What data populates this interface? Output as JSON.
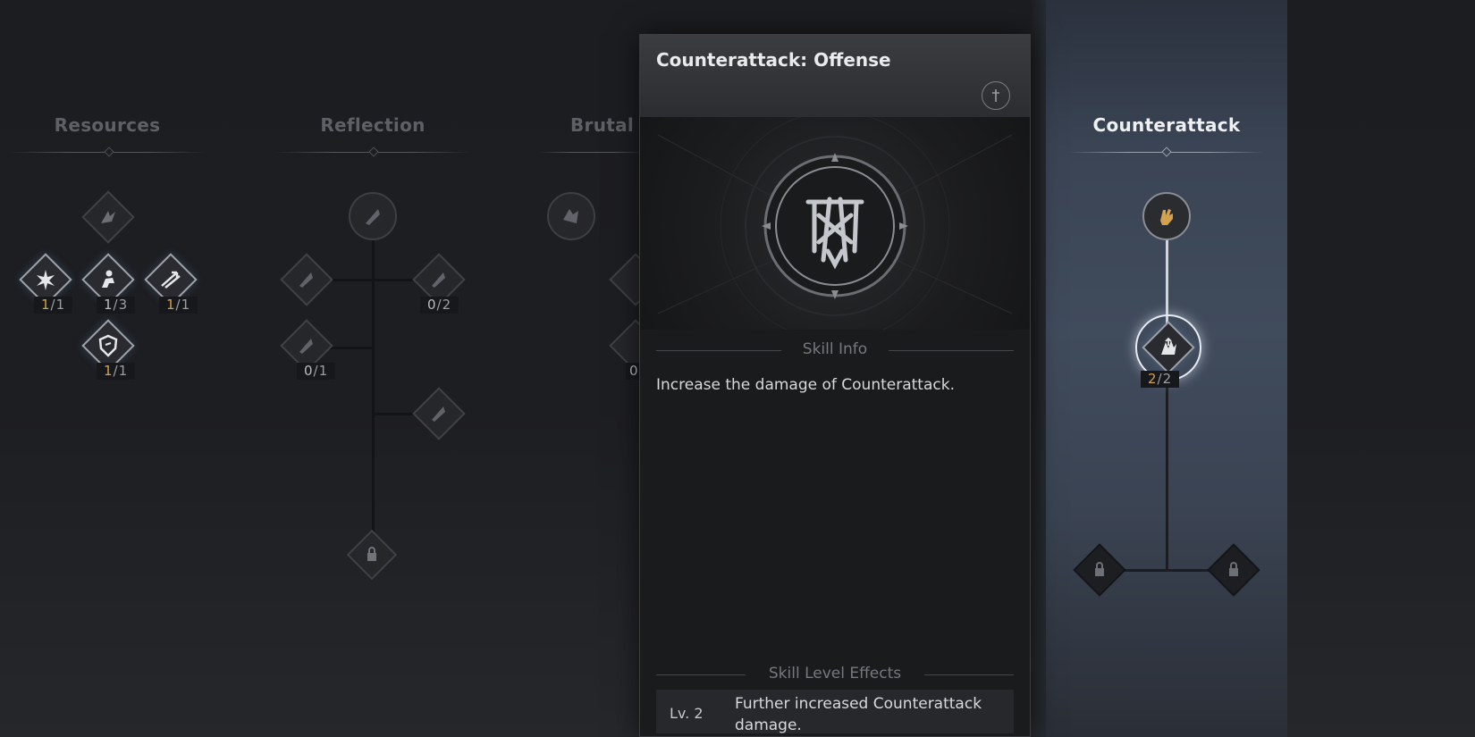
{
  "columns": [
    {
      "title": "Resources"
    },
    {
      "title": "Reflection"
    },
    {
      "title": "Brutal"
    },
    {
      "title": "Counterattack"
    }
  ],
  "resources": {
    "nodes": [
      {
        "name": "claw-skill-icon",
        "count": null
      },
      {
        "name": "burst-skill-icon",
        "cur": "1",
        "max": "/1"
      },
      {
        "name": "crouch-skill-icon",
        "cur": "1",
        "max": "/3"
      },
      {
        "name": "arrows-skill-icon",
        "cur": "1",
        "max": "/1"
      },
      {
        "name": "shield-skill-icon",
        "cur": "1",
        "max": "/1"
      }
    ]
  },
  "reflection": {
    "counts": [
      {
        "cur": "0",
        "max": "/2"
      },
      {
        "cur": "0",
        "max": "/1"
      }
    ]
  },
  "brutal": {
    "partial_count": "0"
  },
  "counterattack": {
    "selected_count_cur": "2",
    "selected_count_max": "/2"
  },
  "panel": {
    "title": "Counterattack: Offense",
    "skill_info_label": "Skill Info",
    "description": "Increase the damage of Counterattack.",
    "level_effects_label": "Skill Level Effects",
    "effects": [
      {
        "level": "Lv. 2",
        "text": "Further increased Counterattack damage."
      }
    ]
  },
  "colors": {
    "accent_gold": "#d2a24c",
    "highlight_column": "#404b5c"
  }
}
